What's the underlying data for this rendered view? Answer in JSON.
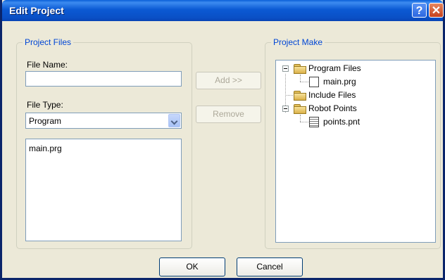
{
  "window": {
    "title": "Edit Project"
  },
  "titlebar": {
    "help_glyph": "?",
    "close_glyph": "✕"
  },
  "project_files": {
    "legend": "Project Files",
    "file_name_label": "File Name:",
    "file_name_value": "",
    "file_type_label": "File Type:",
    "file_type_value": "Program",
    "files": [
      "main.prg"
    ]
  },
  "actions": {
    "add_label": "Add >>",
    "remove_label": "Remove"
  },
  "project_make": {
    "legend": "Project Make",
    "tree": {
      "program_files": "Program Files",
      "main_prg": "main.prg",
      "include_files": "Include Files",
      "robot_points": "Robot Points",
      "points_pnt": "points.pnt"
    }
  },
  "footer": {
    "ok_label": "OK",
    "cancel_label": "Cancel"
  },
  "colors": {
    "title_bar": "#0a5fd8",
    "legend_text": "#0046d5",
    "dialog_bg": "#ece9d8"
  }
}
